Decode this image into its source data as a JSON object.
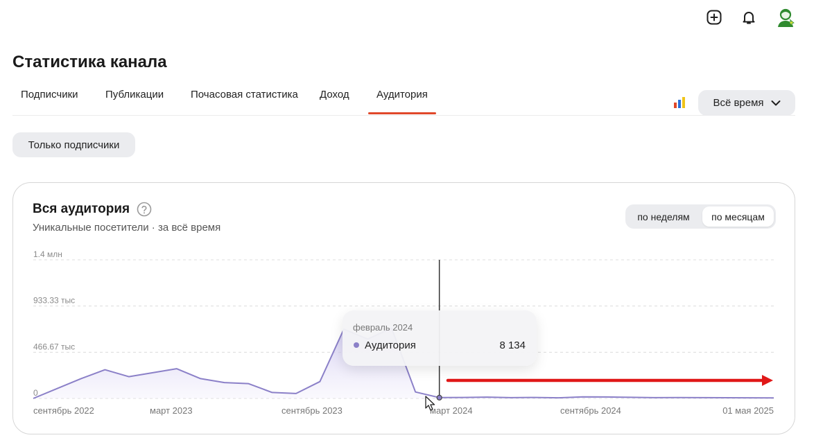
{
  "header": {
    "icons": [
      "add-square-icon",
      "bell-icon",
      "user-avatar-icon"
    ]
  },
  "page": {
    "title": "Статистика канала"
  },
  "tabs": [
    {
      "label": "Подписчики",
      "active": false
    },
    {
      "label": "Публикации",
      "active": false
    },
    {
      "label": "Почасовая статистика",
      "active": false
    },
    {
      "label": "Доход",
      "active": false
    },
    {
      "label": "Аудитория",
      "active": true
    }
  ],
  "range": {
    "label": "Всё время"
  },
  "filter": {
    "label": "Только подписчики"
  },
  "card": {
    "title": "Вся аудитория",
    "subtitle": "Уникальные посетители · за всё время",
    "period": {
      "weeks": "по неделям",
      "months": "по месяцам",
      "selected": "months"
    }
  },
  "tooltip": {
    "date": "февраль 2024",
    "label": "Аудитория",
    "value": "8 134"
  },
  "colors": {
    "accent": "#e0482a",
    "series": "#8b80c8",
    "annotation": "#e01818"
  },
  "chart_data": {
    "type": "area",
    "series": [
      {
        "name": "Аудитория",
        "values": [
          0,
          100000,
          200000,
          290000,
          220000,
          260000,
          300000,
          200000,
          160000,
          150000,
          60000,
          50000,
          170000,
          700000,
          600000,
          710000,
          65000,
          8134,
          10000,
          13000,
          8000,
          10000,
          6000,
          16000,
          15000,
          11000,
          8000,
          9000,
          8000,
          7000,
          6000,
          5000
        ]
      }
    ],
    "ylim": [
      0,
      1400000
    ],
    "y_ticks": [
      "0",
      "466.67 тыс",
      "933.33 тыс",
      "1.4 млн"
    ],
    "x_ticks": [
      "сентябрь 2022",
      "март 2023",
      "сентябрь 2023",
      "март 2024",
      "сентябрь 2024",
      "01 мая 2025"
    ],
    "highlight_point": 17,
    "grid": true,
    "xlabel": "",
    "ylabel": ""
  }
}
